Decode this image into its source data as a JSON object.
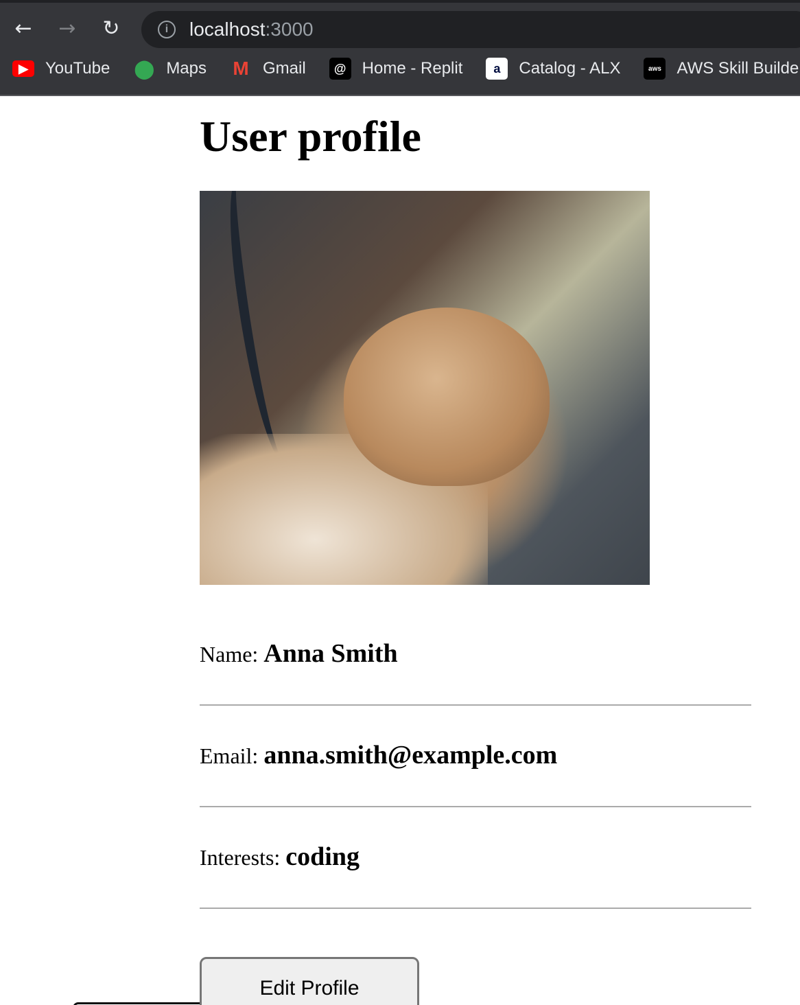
{
  "browser": {
    "url_host": "localhost",
    "url_port": ":3000",
    "bookmarks": [
      {
        "label": "YouTube",
        "icon": "youtube-icon"
      },
      {
        "label": "Maps",
        "icon": "maps-icon"
      },
      {
        "label": "Gmail",
        "icon": "gmail-icon"
      },
      {
        "label": "Home - Replit",
        "icon": "replit-icon"
      },
      {
        "label": "Catalog - ALX",
        "icon": "alx-icon"
      },
      {
        "label": "AWS Skill Builder",
        "icon": "aws-icon"
      }
    ]
  },
  "page": {
    "title": "User profile",
    "fields": [
      {
        "label": "Name:",
        "value": "Anna Smith"
      },
      {
        "label": "Email:",
        "value": "anna.smith@example.com"
      },
      {
        "label": "Interests:",
        "value": "coding"
      }
    ],
    "edit_button": "Edit Profile"
  }
}
